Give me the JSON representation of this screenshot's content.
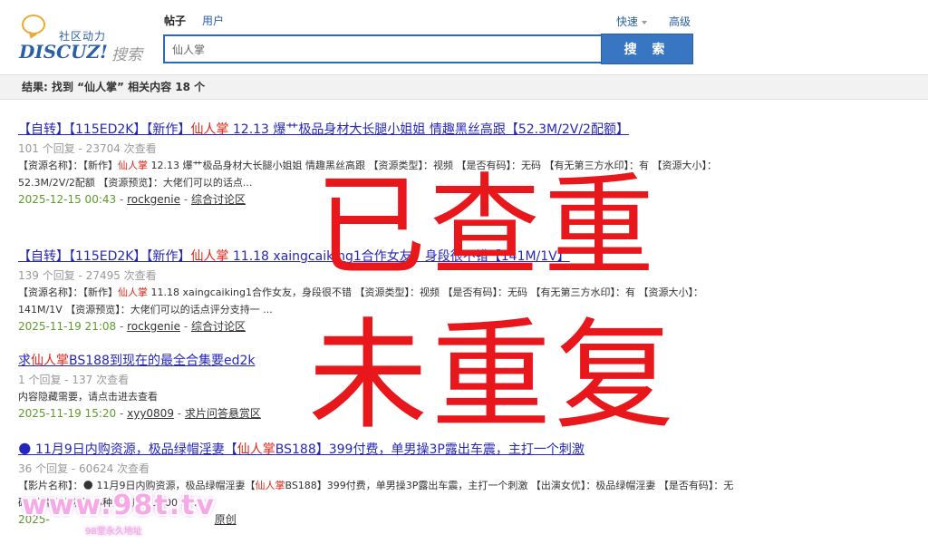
{
  "logo": {
    "slogan": "社区动力",
    "brand": "DISCUZ!",
    "search_word": "搜索"
  },
  "tabs": [
    {
      "label": "帖子",
      "active": true
    },
    {
      "label": "用户",
      "active": false
    }
  ],
  "header_links": {
    "quick": "快速",
    "advanced": "高级"
  },
  "search": {
    "value": "仙人掌",
    "button_label": "搜 索"
  },
  "result_summary": "结果: 找到 “仙人掌” 相关内容 18 个",
  "results": [
    {
      "title_pre": "【自转】【115ED2K】【新作】",
      "title_hl": "仙人掌",
      "title_post": " 12.13 爆艹极品身材大长腿小姐姐 情趣黑丝高跟【52.3M/2V/2配额】",
      "meta": "101 个回复 - 23704 次查看",
      "summary_pre": "【资源名称】：【新作】",
      "summary_hl": "仙人掌",
      "summary_post": " 12.13 爆艹极品身材大长腿小姐姐 情趣黑丝高跟 【资源类型】：视频 【是否有码】：无码 【有无第三方水印】：有 【资源大小】：52.3M/2V/2配额 【资源预览】：大佬们可以的话点...",
      "date": "2025-12-15 00:43",
      "author": "rockgenie",
      "forum": "综合讨论区"
    },
    {
      "title_pre": "【自转】【115ED2K】【新作】",
      "title_hl": "仙人掌",
      "title_post": " 11.18 xaingcaiking1合作女友，身段很不错【141M/1V】",
      "meta": "139 个回复 - 27495 次查看",
      "summary_pre": "【资源名称】：【新作】",
      "summary_hl": "仙人掌",
      "summary_post": " 11.18 xaingcaiking1合作女友，身段很不错 【资源类型】：视频 【是否有码】：无码 【有无第三方水印】：有 【资源大小】：141M/1V 【资源预览】：大佬们可以的话点评分支持一 ...",
      "date": "2025-11-19 21:08",
      "author": "rockgenie",
      "forum": "综合讨论区"
    },
    {
      "title_pre": "求",
      "title_hl": "仙人掌",
      "title_post": "BS188到现在的最全合集要ed2k",
      "meta": "1 个回复 - 137 次查看",
      "summary_pre": "内容隐藏需要，请点击进去查看",
      "summary_hl": "",
      "summary_post": "",
      "date": "2025-11-19 15:20",
      "author": "xyy0809",
      "forum": "求片问答悬赏区"
    },
    {
      "title_pre": "🌑 11月9日内购资源，极品绿帽淫妻【",
      "title_hl": "仙人掌",
      "title_post": "BS188】399付费，单男操3P露出车震，主打一个刺激",
      "meta": "36 个回复 - 60624 次查看",
      "summary_pre": "【影片名称】：🌑 11月9日内购资源，极品绿帽淫妻【",
      "summary_hl": "仙人掌",
      "summary_post": "BS188】399付费，单男操3P露出车震，主打一个刺激 【出演女优】：极品绿帽淫妻 【是否有码】：无码 【种子期限】：5种或健康度1000 【 ...",
      "date": "2025-",
      "author": "",
      "forum": "原创"
    }
  ],
  "stamps": {
    "line1": "已查重",
    "line2": "未重复"
  },
  "watermark": {
    "main": "www.98t.tv",
    "sub": "98堂永久地址"
  },
  "colors": {
    "accent_blue": "#3876c4",
    "link_blue": "#2626b8",
    "highlight_red": "#e0261a",
    "date_green": "#5e9a2b",
    "stamp_red": "#e8171c",
    "watermark_pink": "#f6a9e6"
  }
}
